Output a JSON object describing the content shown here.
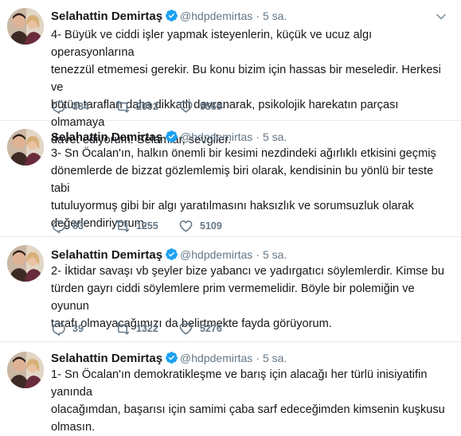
{
  "tweets": [
    {
      "name": "Selahattin Demirtaş",
      "handle": "@hdpdemirtas",
      "separator": "·",
      "time": "5 sa.",
      "lines": [
        "4- Büyük ve ciddi işler yapmak isteyenlerin, küçük ve ucuz algı operasyonlarına",
        "tenezzül etmemesi gerekir. Bu konu bizim için hassas bir meseledir. Herkesi ve",
        "bütün tarafları daha dikkatli davranarak, psikolojik harekatın parçası olmamaya",
        "davet ediyorum. Selamlar, sevgiler."
      ],
      "replies": "384",
      "retweets": "2092",
      "likes": "9569"
    },
    {
      "name": "Selahattin Demirtaş",
      "handle": "@hdpdemirtas",
      "separator": "·",
      "time": "5 sa.",
      "lines": [
        "3- Sn Öcalan'ın, halkın önemli bir kesimi nezdindeki ağırlıklı etkisini geçmiş",
        "dönemlerde de bizzat gözlemlemiş biri olarak, kendisinin bu yönlü bir teste tabi",
        "tutuluyormuş gibi bir algı yaratılmasını haksızlık ve sorumsuzluk olarak",
        "değerlendiriyorum."
      ],
      "replies": "83",
      "retweets": "1255",
      "likes": "5109"
    },
    {
      "name": "Selahattin Demirtaş",
      "handle": "@hdpdemirtas",
      "separator": "·",
      "time": "5 sa.",
      "lines": [
        "2- İktidar savaşı vb şeyler bize yabancı ve yadırgatıcı söylemlerdir. Kimse bu",
        "türden gayrı ciddi söylemlere prim vermemelidir. Böyle bir polemiğin ve oyunun",
        "tarafı olmayacağımızı da belirtmekte fayda görüyorum."
      ],
      "replies": "39",
      "retweets": "1322",
      "likes": "5276"
    },
    {
      "name": "Selahattin Demirtaş",
      "handle": "@hdpdemirtas",
      "separator": "·",
      "time": "5 sa.",
      "lines": [
        "1- Sn Öcalan'ın demokratikleşme ve barış için alacağı her türlü inisiyatifin yanında",
        "olacağımdan, başarısı için samimi çaba sarf edeceğimden kimsenin kuşkusu",
        "olmasın."
      ]
    }
  ],
  "icons": {
    "verified": "verified-badge-icon",
    "caret": "chevron-down-icon",
    "reply": "reply-icon",
    "retweet": "retweet-icon",
    "like": "heart-icon"
  },
  "colors": {
    "text": "#14171a",
    "secondary": "#657786",
    "verified": "#1da1f2",
    "divider": "#e6ecf0"
  }
}
